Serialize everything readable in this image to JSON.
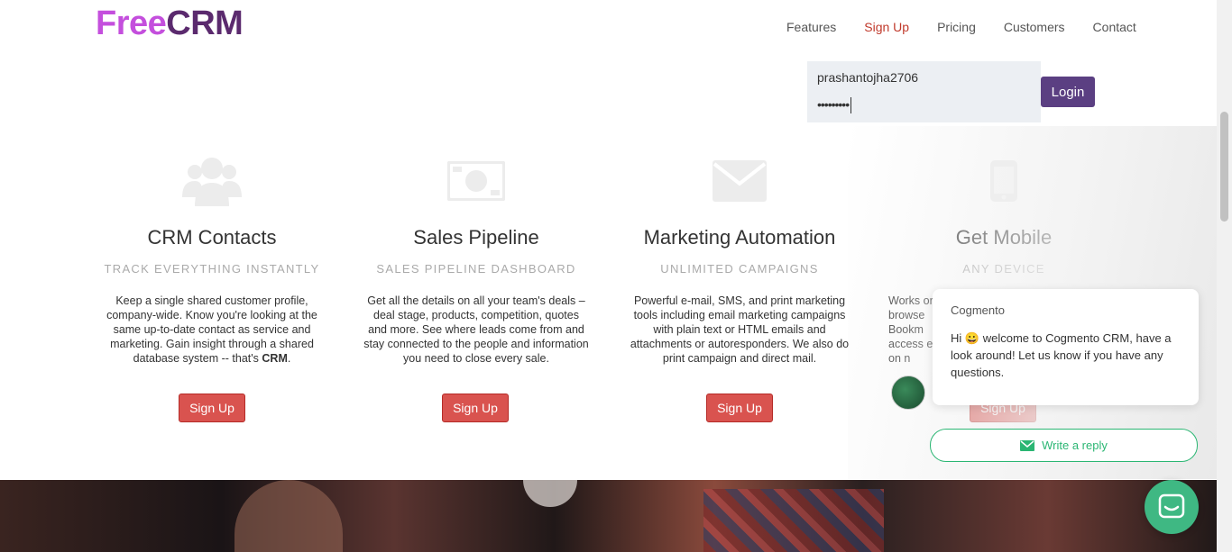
{
  "logo": {
    "part1": "Free",
    "part2": "CRM"
  },
  "nav": [
    "Features",
    "Sign Up",
    "Pricing",
    "Customers",
    "Contact"
  ],
  "login": {
    "username": "prashantojha2706",
    "password": "•••••••••",
    "button": "Login"
  },
  "features": [
    {
      "icon": "users-icon",
      "title": "CRM Contacts",
      "subtitle": "TRACK EVERYTHING INSTANTLY",
      "desc": "Keep a single shared customer profile, company-wide. Know you're looking at the same up-to-date contact as service and marketing. Gain insight through a shared database system -- that's",
      "desc_bold": "CRM",
      "button": "Sign Up"
    },
    {
      "icon": "money-icon",
      "title": "Sales Pipeline",
      "subtitle": "SALES PIPELINE DASHBOARD",
      "desc": "Get all the details on all your team's deals – deal stage, products, competition, quotes and more. See where leads come from and stay connected to the people and information you need to close every sale.",
      "button": "Sign Up"
    },
    {
      "icon": "envelope-icon",
      "title": "Marketing Automation",
      "subtitle": "UNLIMITED CAMPAIGNS",
      "desc": "Powerful e-mail, SMS, and print marketing tools including email marketing campaigns with plain text or HTML emails and attachments or autoresponders. We also do print campaign and direct mail.",
      "button": "Sign Up"
    },
    {
      "icon": "mobile-icon",
      "title": "Get Mobile",
      "subtitle": "ANY DEVICE",
      "desc": "Works or browse Bookm access e on n",
      "button": "Sign Up"
    }
  ],
  "chat": {
    "from": "Cogmento",
    "message_hi": "Hi",
    "message_rest": " welcome to Cogmento CRM,  have a look around! Let us know if you have any questions.",
    "reply": "Write a reply"
  }
}
